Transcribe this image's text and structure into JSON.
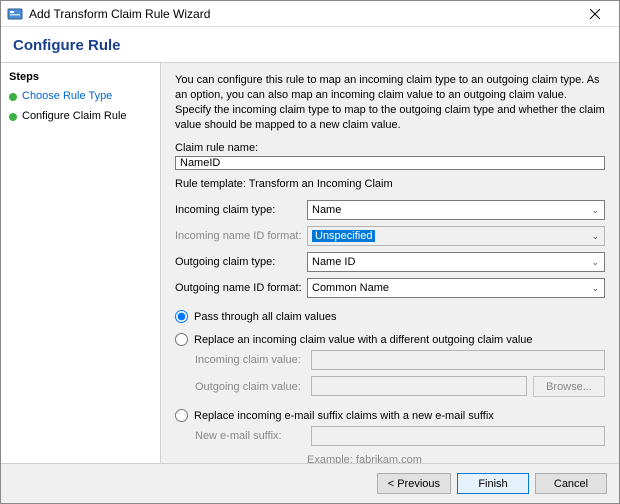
{
  "window": {
    "title": "Add Transform Claim Rule Wizard"
  },
  "header": "Configure Rule",
  "sidebar": {
    "heading": "Steps",
    "items": [
      {
        "label": "Choose Rule Type"
      },
      {
        "label": "Configure Claim Rule"
      }
    ]
  },
  "main": {
    "description": "You can configure this rule to map an incoming claim type to an outgoing claim type. As an option, you can also map an incoming claim value to an outgoing claim value. Specify the incoming claim type to map to the outgoing claim type and whether the claim value should be mapped to a new claim value.",
    "rule_name_label": "Claim rule name:",
    "rule_name_value": "NameID",
    "template_label": "Rule template: Transform an Incoming Claim",
    "fields": {
      "incoming_type_label": "Incoming claim type:",
      "incoming_type_value": "Name",
      "incoming_nameid_label": "Incoming name ID format:",
      "incoming_nameid_value": "Unspecified",
      "outgoing_type_label": "Outgoing claim type:",
      "outgoing_type_value": "Name ID",
      "outgoing_nameid_label": "Outgoing name ID format:",
      "outgoing_nameid_value": "Common Name"
    },
    "radios": {
      "pass": "Pass through all claim values",
      "replace": "Replace an incoming claim value with a different outgoing claim value",
      "suffix": "Replace incoming e-mail suffix claims with a new e-mail suffix"
    },
    "replace_fields": {
      "incoming_label": "Incoming claim value:",
      "outgoing_label": "Outgoing claim value:",
      "browse": "Browse..."
    },
    "suffix_fields": {
      "label": "New e-mail suffix:",
      "example": "Example: fabrikam.com"
    }
  },
  "footer": {
    "previous": "< Previous",
    "finish": "Finish",
    "cancel": "Cancel"
  }
}
